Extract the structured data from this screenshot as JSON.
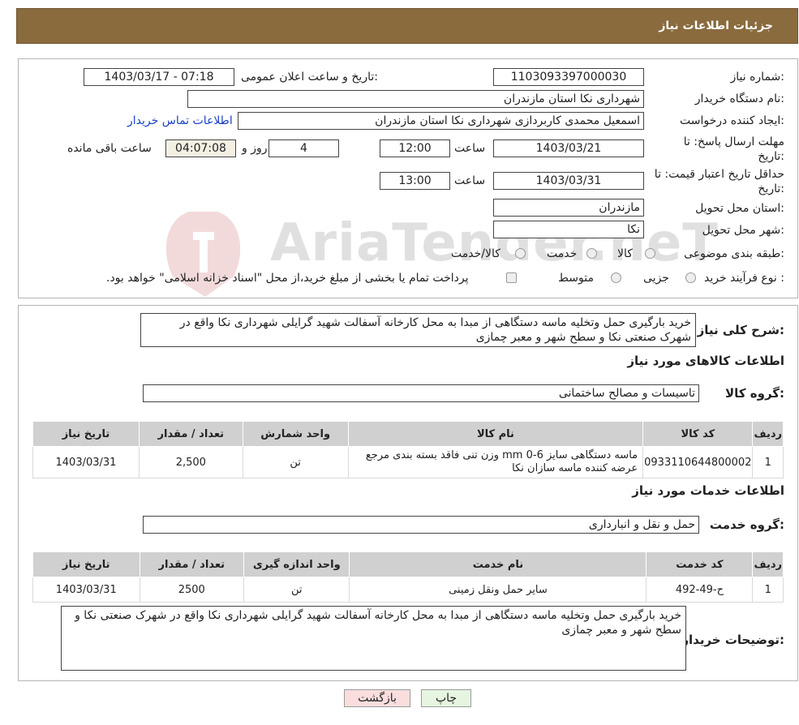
{
  "header": {
    "title": "جزئیات اطلاعات نیاز"
  },
  "watermark": {
    "text": "AriaTender.neT"
  },
  "info": {
    "need_number_label": "شماره نیاز:",
    "need_number": "1103093397000030",
    "announce_label": "تاریخ و ساعت اعلان عمومی:",
    "announce_value": "1403/03/17 - 07:18",
    "buyer_label": "نام دستگاه خریدار:",
    "buyer_value": "شهرداری نکا استان مازندران",
    "creator_label": "ایجاد کننده درخواست:",
    "creator_value": "اسمعیل محمدی کاربردازی شهرداری نکا استان مازندران",
    "contact_link": "اطلاعات تماس خریدار",
    "deadline_label_1": "مهلت ارسال پاسخ: تا",
    "deadline_label_2": "تاریخ:",
    "deadline_date": "1403/03/21",
    "time_label": "ساعت",
    "deadline_time": "12:00",
    "days_value": "4",
    "days_label": "روز و",
    "remaining_value": "04:07:08",
    "remaining_label": "ساعت باقی مانده",
    "validity_label_1": "حداقل تاریخ اعتبار قیمت: تا",
    "validity_label_2": "تاریخ:",
    "validity_date": "1403/03/31",
    "validity_time": "13:00",
    "province_label": "استان محل تحویل:",
    "province_value": "مازندران",
    "city_label": "شهر محل تحویل:",
    "city_value": "نکا",
    "category_label": "طبقه بندی موضوعی:",
    "category_options": [
      "کالا",
      "خدمت",
      "کالا/خدمت"
    ],
    "process_label": "نوع فرآیند خرید :",
    "process_options": [
      "جزیی",
      "متوسط"
    ],
    "process_note": "پرداخت تمام یا بخشی از مبلغ خرید،از محل \"اسناد خزانه اسلامی\" خواهد بود."
  },
  "description": {
    "label": "شرح کلی نیاز:",
    "text": "خرید بارگیری حمل وتخلیه ماسه دستگاهی از مبدا به محل کارخانه آسفالت شهید گرایلی شهرداری نکا واقع در شهرک صنعتی نکا و سطح شهر و معبر چمازی"
  },
  "goods": {
    "section_title": "اطلاعات کالاهای مورد نیاز",
    "group_label": "گروه کالا:",
    "group_value": "تاسیسات و مصالح ساختمانی",
    "headers": [
      "ردیف",
      "کد کالا",
      "نام کالا",
      "واحد شمارش",
      "تعداد / مقدار",
      "تاریخ نیاز"
    ],
    "rows": [
      [
        "1",
        "0933110644800002",
        "ماسه دستگاهی سایز 6-0 mm وزن تنی فاقد بسته بندی مرجع عرضه کننده ماسه سازان نکا",
        "تن",
        "2,500",
        "1403/03/31"
      ]
    ]
  },
  "services": {
    "section_title": "اطلاعات خدمات مورد نیاز",
    "group_label": "گروه خدمت:",
    "group_value": "حمل و نقل و انبارداری",
    "headers": [
      "ردیف",
      "کد خدمت",
      "نام خدمت",
      "واحد اندازه گیری",
      "تعداد / مقدار",
      "تاریخ نیاز"
    ],
    "rows": [
      [
        "1",
        "ح-49-492",
        "سایر حمل ونقل زمینی",
        "تن",
        "2500",
        "1403/03/31"
      ]
    ]
  },
  "buyer_notes": {
    "label": "توضیحات خریدار:",
    "text": "خرید بارگیری حمل وتخلیه ماسه دستگاهی از مبدا به محل کارخانه آسفالت شهید گرایلی شهرداری نکا واقع در شهرک صنعتی نکا و سطح شهر و معبر چمازی"
  },
  "buttons": {
    "print": "چاپ",
    "back": "بازگشت"
  },
  "colors": {
    "header_bg": "#8a6b3e",
    "link": "#1a3fc6",
    "back_button_bg": "#fadede",
    "print_button_bg": "#e6f5df"
  }
}
